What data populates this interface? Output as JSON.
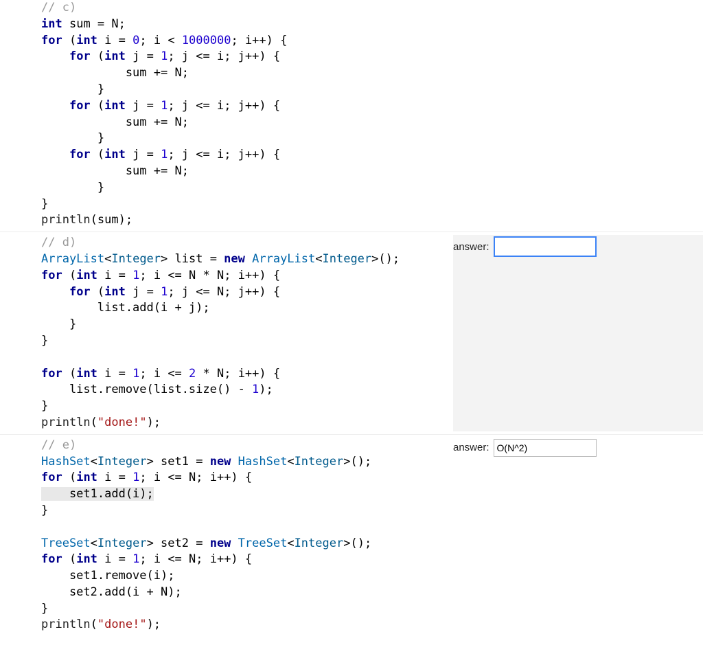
{
  "answers": {
    "label": "answer:",
    "c_value": "",
    "d_value": "",
    "e_value": "O(N^2)"
  },
  "code": {
    "c": {
      "l00": "// c)",
      "int": "int",
      "sum": "sum",
      "eq": " = ",
      "N": "N",
      "sc": ";",
      "for": "for",
      "lp": " (",
      "i": "i",
      "eq0": " = ",
      "z": "0",
      "lt": "; i < ",
      "mil": "1000000",
      "ipp": "; i++) {",
      "for_j": "for",
      "lpj": " (",
      "intj": "int",
      "j": " j",
      "eq1": " = ",
      "one": "1",
      "cond": "; j <= i; j++) {",
      "body": "            sum += N;",
      "rb": "        }",
      "rb0": "    }",
      "rb1": "}",
      "print": "println",
      "arg": "(sum);"
    },
    "d": {
      "cm": "// d)",
      "al": "ArrayList",
      "int": "Integer",
      "list": " list = ",
      "new": "new",
      "al2": " ArrayList",
      "end": "();",
      "for": "for",
      "f1": " (",
      "inti": "int",
      "i": " i",
      "eq1": " = ",
      "one": "1",
      "cnd1": "; i <= N * N; i++) {",
      "for2": "for",
      "f2": " (",
      "intj": "int",
      "j": " j",
      "eq2": " = ",
      "one2": "1",
      "cnd2": "; j <= N; j++) {",
      "add": "        list.add(i + j);",
      "rb1": "    }",
      "rb0": "}",
      "blank": "",
      "for3": "for",
      "f3": " (",
      "inti3": "int",
      "i3": " i",
      "eq3": " = ",
      "one3": "1",
      "cnd3": "; i <= ",
      "two": "2",
      "cnd3b": " * N; i++) {",
      "rem": "    list.remove(list.size() - ",
      "one4": "1",
      "remend": ");",
      "rb2": "}",
      "print": "println",
      "arg": "(",
      "done": "\"done!\"",
      "pe": ");"
    },
    "e": {
      "cm": "// e)",
      "hs": "HashSet",
      "int": "Integer",
      "set1": " set1 = ",
      "new": "new",
      "hs2": " HashSet",
      "end": "();",
      "for": "for",
      "f1": " (",
      "inti": "int",
      "i": " i",
      "eq1": " = ",
      "one": "1",
      "cnd1": "; i <= N; i++) {",
      "add": "    set1.add(i);",
      "rb0": "}",
      "blank": "",
      "ts": "TreeSet",
      "set2": " set2 = ",
      "ts2": " TreeSet",
      "end2": "();",
      "for2": "for",
      "f2": " (",
      "inti2": "int",
      "i2": " i",
      "eq2": " = ",
      "one2": "1",
      "cnd2": "; i <= N; i++) {",
      "rem": "    set1.remove(i);",
      "add2": "    set2.add(i + N);",
      "rb1": "}",
      "print": "println",
      "arg": "(",
      "done": "\"done!\"",
      "pe": ");"
    }
  }
}
